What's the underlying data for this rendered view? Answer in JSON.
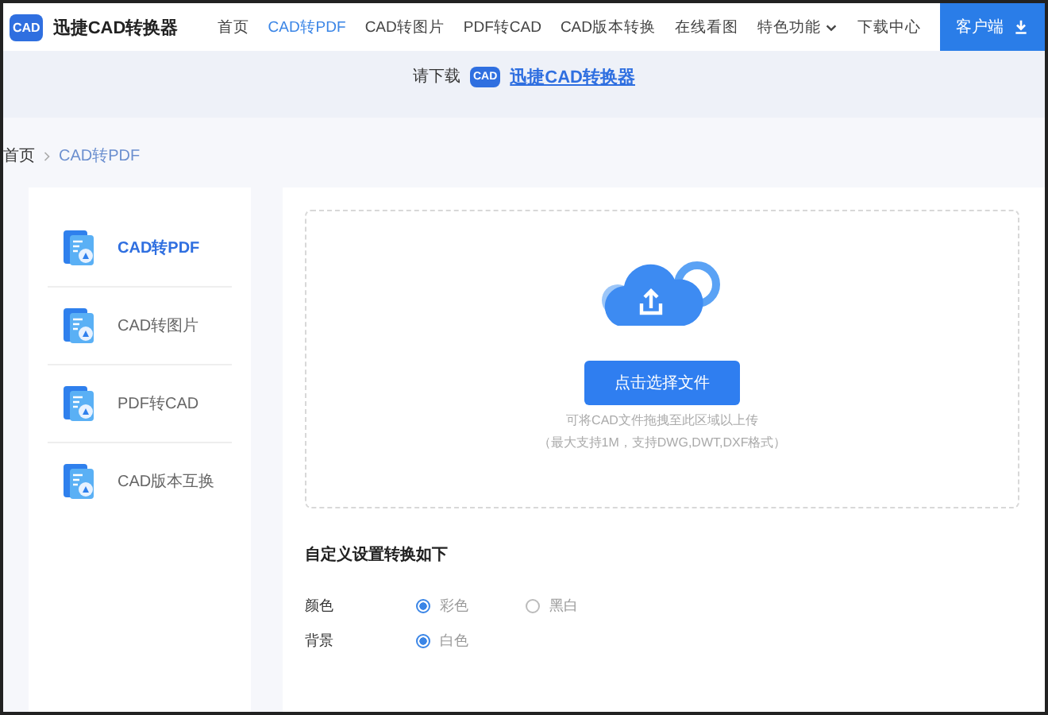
{
  "header": {
    "logo_badge": "CAD",
    "logo_text": "迅捷CAD转换器",
    "nav": [
      {
        "label": "首页",
        "selected": false,
        "dropdown": false
      },
      {
        "label": "CAD转PDF",
        "selected": true,
        "dropdown": false
      },
      {
        "label": "CAD转图片",
        "selected": false,
        "dropdown": false
      },
      {
        "label": "PDF转CAD",
        "selected": false,
        "dropdown": false
      },
      {
        "label": "CAD版本转换",
        "selected": false,
        "dropdown": false
      },
      {
        "label": "在线看图",
        "selected": false,
        "dropdown": false
      },
      {
        "label": "特色功能",
        "selected": false,
        "dropdown": true
      },
      {
        "label": "下载中心",
        "selected": false,
        "dropdown": false
      }
    ],
    "client_button": "客户端"
  },
  "banner": {
    "prompt": "请下载",
    "app_badge": "CAD",
    "app_link": "迅捷CAD转换器"
  },
  "breadcrumb": [
    "首页",
    "CAD转PDF"
  ],
  "sidebar": {
    "items": [
      {
        "label": "CAD转PDF",
        "selected": true
      },
      {
        "label": "CAD转图片",
        "selected": false
      },
      {
        "label": "PDF转CAD",
        "selected": false
      },
      {
        "label": "CAD版本互换",
        "selected": false
      }
    ]
  },
  "upload": {
    "button": "点击选择文件",
    "hint_lines": [
      "可将CAD文件拖拽至此区域以上传",
      "（最大支持1M，支持DWG,DWT,DXF格式）"
    ]
  },
  "settings": {
    "title": "自定义设置转换如下",
    "rows": [
      {
        "label": "颜色",
        "options": [
          {
            "label": "彩色",
            "selected": true
          },
          {
            "label": "黑白",
            "selected": false
          }
        ]
      },
      {
        "label": "背景",
        "options": [
          {
            "label": "白色",
            "selected": true
          }
        ]
      }
    ]
  }
}
